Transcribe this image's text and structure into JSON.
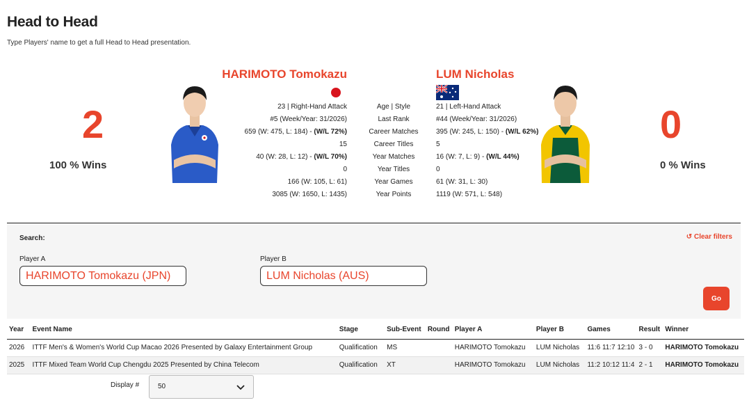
{
  "page": {
    "title": "Head to Head",
    "subtitle": "Type Players' name to get a full Head to Head presentation."
  },
  "player_a": {
    "name": "HARIMOTO Tomokazu",
    "wins": "2",
    "wins_pct": "100 % Wins",
    "stats": [
      "23 | Right-Hand Attack",
      "#5 (Week/Year: 31/2026)",
      "659 (W: 475, L: 184) - ",
      "15",
      "40 (W: 28, L: 12) - ",
      "0",
      "166 (W: 105, L: 61)",
      "3085 (W: 1650, L: 1435)"
    ],
    "career_wl": "(W/L 72%)",
    "year_wl": "(W/L 70%)"
  },
  "player_b": {
    "name": "LUM Nicholas",
    "wins": "0",
    "wins_pct": "0 % Wins",
    "stats": [
      "21 | Left-Hand Attack",
      "#44 (Week/Year: 31/2026)",
      "395 (W: 245, L: 150) - ",
      "5",
      "16 (W: 7, L: 9) - ",
      "0",
      "61 (W: 31, L: 30)",
      "1119 (W: 571, L: 548)"
    ],
    "career_wl": "(W/L 62%)",
    "year_wl": "(W/L 44%)"
  },
  "stat_labels": [
    "Age | Style",
    "Last Rank",
    "Career Matches",
    "Career Titles",
    "Year Matches",
    "Year Titles",
    "Year Games",
    "Year Points"
  ],
  "filters": {
    "search_label": "Search:",
    "clear_label": "Clear filters",
    "player_a_label": "Player A",
    "player_a_value": "HARIMOTO Tomokazu (JPN)",
    "player_b_label": "Player B",
    "player_b_value": "LUM Nicholas (AUS)",
    "go_label": "Go"
  },
  "table": {
    "headers": [
      "Year",
      "Event Name",
      "Stage",
      "Sub-Event",
      "Round",
      "Player A",
      "Player B",
      "Games",
      "Result",
      "Winner"
    ],
    "rows": [
      [
        "2026",
        "ITTF Men's & Women's World Cup Macao 2026 Presented by Galaxy Entertainment Group",
        "Qualification",
        "MS",
        "",
        "HARIMOTO Tomokazu",
        "LUM Nicholas",
        "11:6 11:7 12:10",
        "3 - 0",
        "HARIMOTO Tomokazu"
      ],
      [
        "2025",
        "ITTF Mixed Team World Cup Chengdu 2025 Presented by China Telecom",
        "Qualification",
        "XT",
        "",
        "HARIMOTO Tomokazu",
        "LUM Nicholas",
        "11:2 10:12 11:4",
        "2 - 1",
        "HARIMOTO Tomokazu"
      ]
    ]
  },
  "display": {
    "label": "Display #",
    "value": "50"
  },
  "colors": {
    "accent": "#e8452c",
    "japan_red": "#d8141d",
    "aus_blue": "#0a2a78"
  }
}
